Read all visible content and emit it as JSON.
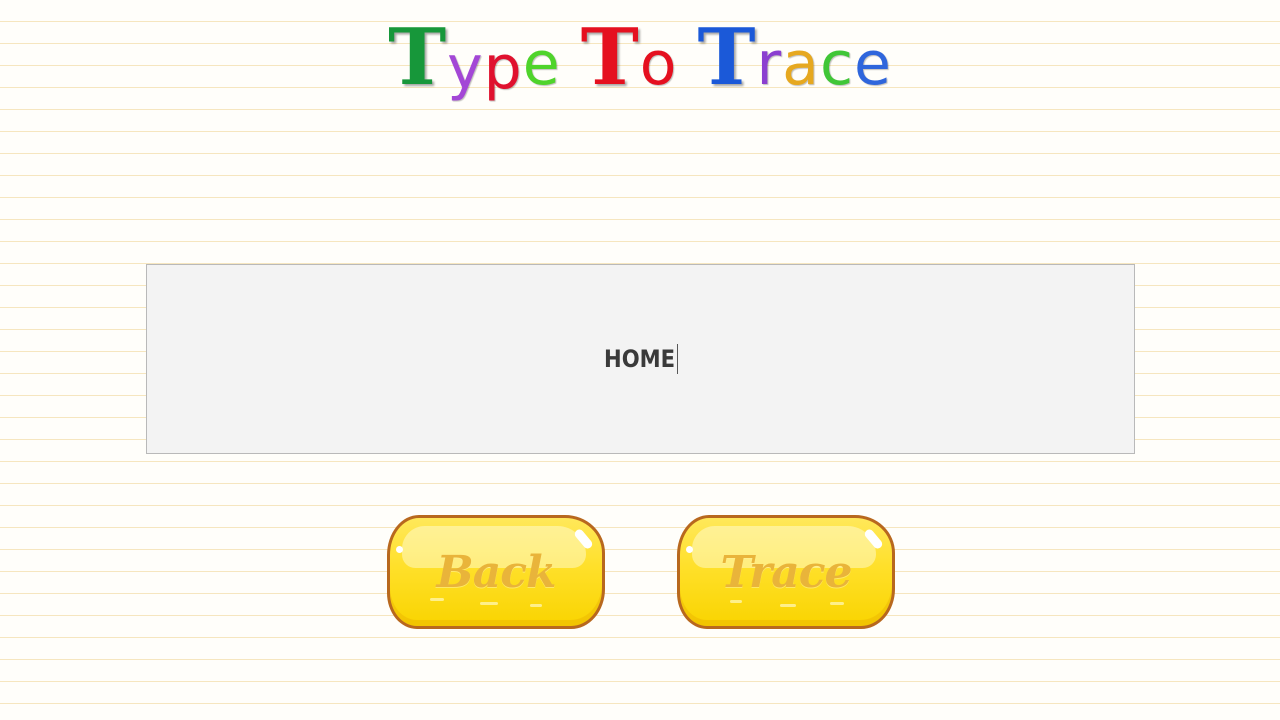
{
  "header": {
    "title_words": [
      [
        {
          "ch": "T",
          "color": "#17973a",
          "cap": true
        },
        {
          "ch": "y",
          "color": "#a347d6"
        },
        {
          "ch": "p",
          "color": "#e0112e"
        },
        {
          "ch": "e",
          "color": "#4fd42b"
        }
      ],
      [
        {
          "ch": "T",
          "color": "#e5101f",
          "cap": true
        },
        {
          "ch": "o",
          "color": "#e5101f"
        }
      ],
      [
        {
          "ch": "T",
          "color": "#1b59d8",
          "cap": true
        },
        {
          "ch": "r",
          "color": "#8b3fd0"
        },
        {
          "ch": "a",
          "color": "#e6a81f"
        },
        {
          "ch": "c",
          "color": "#40c637"
        },
        {
          "ch": "e",
          "color": "#2f66dc"
        }
      ]
    ]
  },
  "entry": {
    "value": "HOME"
  },
  "buttons": {
    "back_label": "Back",
    "trace_label": "Trace"
  }
}
